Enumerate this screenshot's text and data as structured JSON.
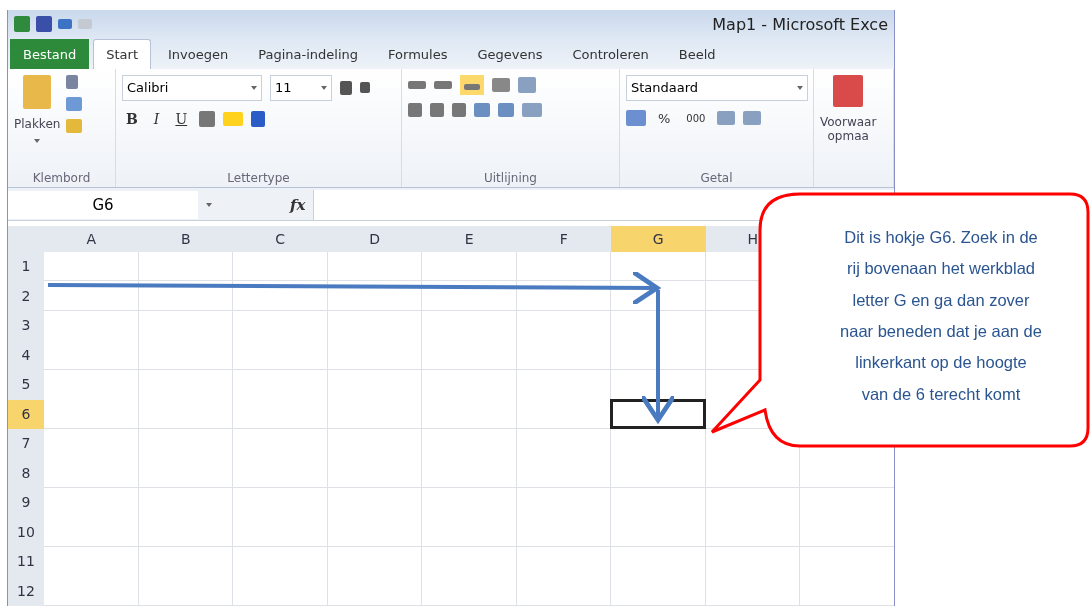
{
  "window": {
    "title": "Map1 - Microsoft Exce"
  },
  "tabs": [
    {
      "label": "Bestand",
      "kind": "file",
      "selected": false
    },
    {
      "label": "Start",
      "kind": "tab",
      "selected": true
    },
    {
      "label": "Invoegen",
      "kind": "tab",
      "selected": false
    },
    {
      "label": "Pagina-indeling",
      "kind": "tab",
      "selected": false
    },
    {
      "label": "Formules",
      "kind": "tab",
      "selected": false
    },
    {
      "label": "Gegevens",
      "kind": "tab",
      "selected": false
    },
    {
      "label": "Controleren",
      "kind": "tab",
      "selected": false
    },
    {
      "label": "Beeld",
      "kind": "tab",
      "selected": false
    }
  ],
  "ribbon": {
    "clipboard": {
      "paste": "Plakken",
      "group": "Klembord"
    },
    "font": {
      "name": "Calibri",
      "size": "11",
      "bold": "B",
      "italic": "I",
      "underline": "U",
      "group": "Lettertype"
    },
    "alignment": {
      "group": "Uitlijning"
    },
    "number": {
      "format": "Standaard",
      "percent": "%",
      "thousands": "000",
      "group": "Getal"
    },
    "conditional": {
      "line_1": "Voorwaar",
      "line_2": "opmaa"
    }
  },
  "formula_bar": {
    "name_box": "G6",
    "fx": "fx"
  },
  "sheet": {
    "columns": [
      {
        "label": "A",
        "selected": false
      },
      {
        "label": "B",
        "selected": false
      },
      {
        "label": "C",
        "selected": false
      },
      {
        "label": "D",
        "selected": false
      },
      {
        "label": "E",
        "selected": false
      },
      {
        "label": "F",
        "selected": false
      },
      {
        "label": "G",
        "selected": true
      },
      {
        "label": "H",
        "selected": false
      }
    ],
    "rows": [
      {
        "label": "1",
        "selected": false
      },
      {
        "label": "2",
        "selected": false
      },
      {
        "label": "3",
        "selected": false
      },
      {
        "label": "4",
        "selected": false
      },
      {
        "label": "5",
        "selected": false
      },
      {
        "label": "6",
        "selected": true
      },
      {
        "label": "7",
        "selected": false
      },
      {
        "label": "8",
        "selected": false
      },
      {
        "label": "9",
        "selected": false
      },
      {
        "label": "10",
        "selected": false
      },
      {
        "label": "11",
        "selected": false
      },
      {
        "label": "12",
        "selected": false
      }
    ]
  },
  "callout": {
    "lines": [
      "Dit is hokje G6. Zoek in de",
      "rij bovenaan het werkblad",
      "letter G en ga dan zover",
      "naar beneden dat je aan de",
      "linkerkant op de hoogte",
      "van de 6 terecht komt"
    ]
  }
}
